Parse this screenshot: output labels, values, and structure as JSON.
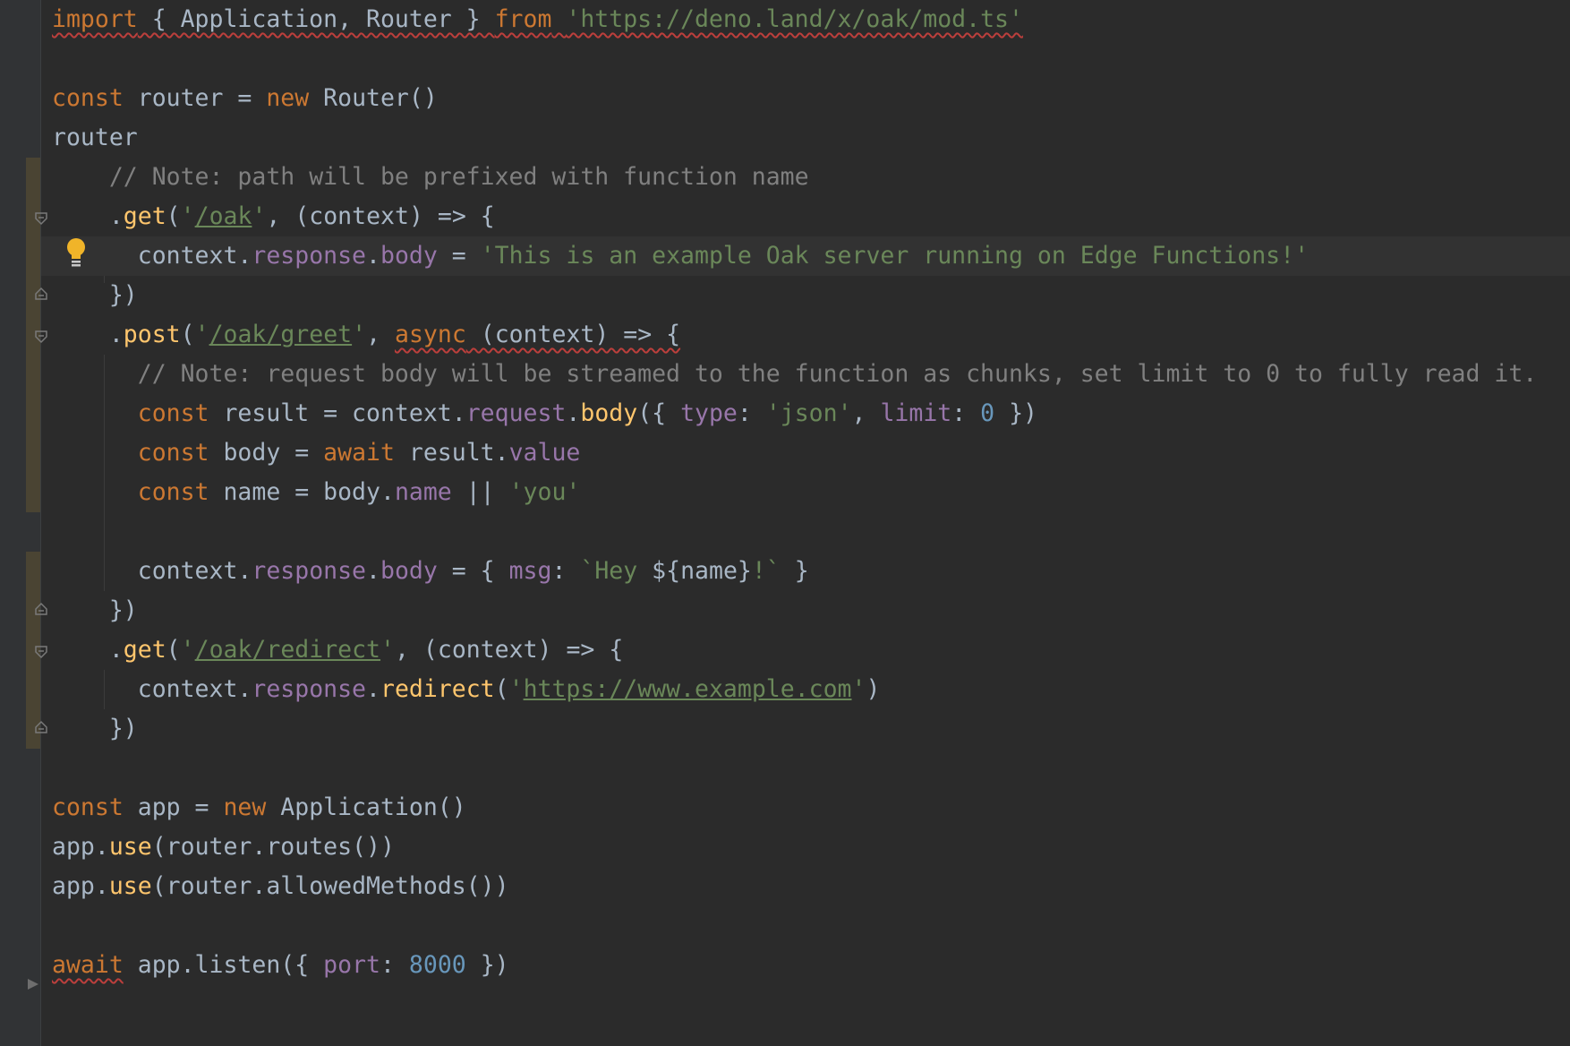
{
  "editor": {
    "colors": {
      "background": "#2b2b2b",
      "keyword": "#cc7832",
      "string": "#6a8759",
      "comment": "#808080",
      "property": "#9876aa",
      "function": "#ffc66d",
      "number": "#6897bb",
      "text": "#a9b7c6",
      "warning_bulb": "#f0b429"
    },
    "gutter_icons": [
      "fold-icon",
      "unfold-icon",
      "lightbulb-icon",
      "run-gutter-icon"
    ],
    "code": {
      "l1": {
        "kw_import": "import",
        "t1": " { Application, Router } ",
        "kw_from": "from",
        "sp": " ",
        "str_url": "'https://deno.land/x/oak/mod.ts'"
      },
      "l3": {
        "kw_const": "const",
        "t1": " router = ",
        "kw_new": "new",
        "t2": " Router()"
      },
      "l4": {
        "t1": "router"
      },
      "l5": {
        "indent": "    ",
        "comment": "// Note: path will be prefixed with function name"
      },
      "l6": {
        "indent": "    ",
        "dot": ".",
        "fn_get": "get",
        "p1": "(",
        "q1": "'",
        "path": "/oak",
        "q2": "'",
        "t2": ", (context) => {"
      },
      "l7": {
        "indent": "      ",
        "t1": "context.",
        "p_response": "response",
        "dot": ".",
        "p_body": "body",
        "t2": " = ",
        "str": "'This is an example Oak server running on Edge Functions!'"
      },
      "l8": {
        "indent": "    ",
        "t1": "})"
      },
      "l9": {
        "indent": "    ",
        "dot": ".",
        "fn_post": "post",
        "p1": "(",
        "q1": "'",
        "path": "/oak/greet",
        "q2": "'",
        "t2": ", ",
        "kw_async": "async",
        "t3": " (context) => {"
      },
      "l10": {
        "indent": "      ",
        "comment": "// Note: request body will be streamed to the function as chunks, set limit to 0 to fully read it."
      },
      "l11": {
        "indent": "      ",
        "kw_const": "const",
        "t1": " result = context.",
        "p_request": "request",
        "dot": ".",
        "fn_body": "body",
        "t2": "({ ",
        "p_type": "type",
        "t3": ": ",
        "str_json": "'json'",
        "t4": ", ",
        "p_limit": "limit",
        "t5": ": ",
        "num": "0",
        "t6": " })"
      },
      "l12": {
        "indent": "      ",
        "kw_const": "const",
        "t1": " body = ",
        "kw_await": "await",
        "t2": " result.",
        "p_value": "value"
      },
      "l13": {
        "indent": "      ",
        "kw_const": "const",
        "t1": " name = body.",
        "p_name": "name",
        "t2": " || ",
        "str_you": "'you'"
      },
      "l15": {
        "indent": "      ",
        "t1": "context.",
        "p_response": "response",
        "dot": ".",
        "p_body": "body",
        "t2": " = { ",
        "p_msg": "msg",
        "t3": ": ",
        "tpl1": "`Hey ",
        "tpl_expr": "${name}",
        "tpl2": "!`",
        "t4": " }"
      },
      "l16": {
        "indent": "    ",
        "t1": "})"
      },
      "l17": {
        "indent": "    ",
        "dot": ".",
        "fn_get": "get",
        "p1": "(",
        "q1": "'",
        "path": "/oak/redirect",
        "q2": "'",
        "t2": ", (context) => {"
      },
      "l18": {
        "indent": "      ",
        "t1": "context.",
        "p_response": "response",
        "dot": ".",
        "fn_redirect": "redirect",
        "p1": "(",
        "q1": "'",
        "url": "https://www.example.com",
        "q2": "'",
        "p2": ")"
      },
      "l19": {
        "indent": "    ",
        "t1": "})"
      },
      "l21": {
        "kw_const": "const",
        "t1": " app = ",
        "kw_new": "new",
        "t2": " Application()"
      },
      "l22": {
        "t1": "app.",
        "fn_use": "use",
        "t2": "(router.routes())"
      },
      "l23": {
        "t1": "app.",
        "fn_use": "use",
        "t2": "(router.allowedMethods())"
      },
      "l25": {
        "kw_await": "await",
        "t1": " app.listen({ ",
        "p_port": "port",
        "t2": ": ",
        "num": "8000",
        "t3": " })"
      }
    }
  }
}
